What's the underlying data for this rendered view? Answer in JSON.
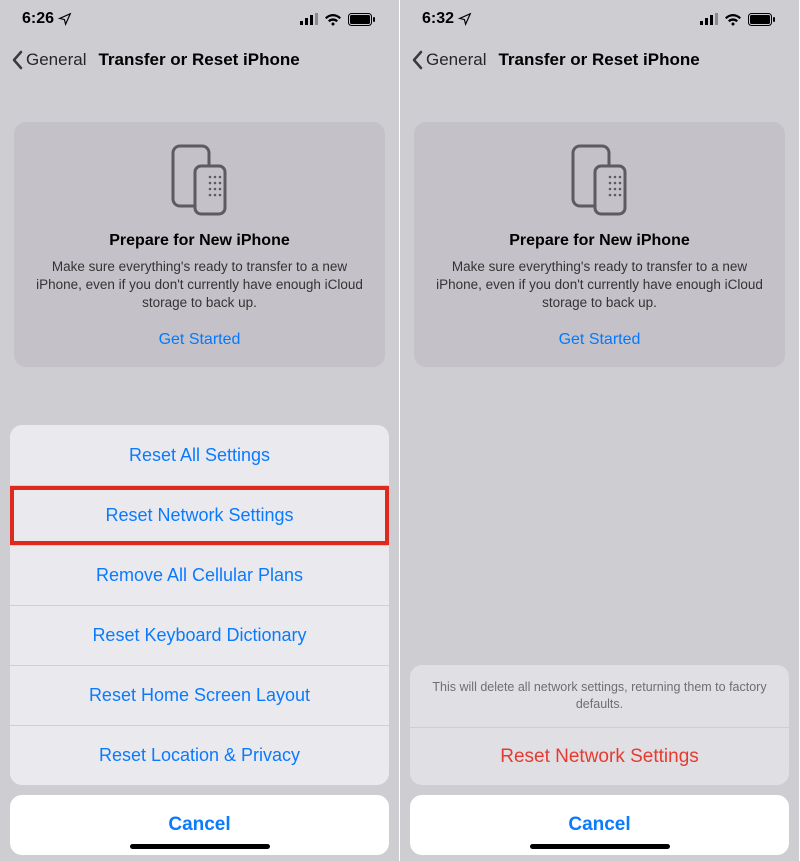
{
  "left": {
    "status": {
      "time": "6:26"
    },
    "nav": {
      "back": "General",
      "title": "Transfer or Reset iPhone"
    },
    "card": {
      "title": "Prepare for New iPhone",
      "body": "Make sure everything's ready to transfer to a new iPhone, even if you don't currently have enough iCloud storage to back up.",
      "cta": "Get Started"
    },
    "sheet": {
      "items": [
        "Reset All Settings",
        "Reset Network Settings",
        "Remove All Cellular Plans",
        "Reset Keyboard Dictionary",
        "Reset Home Screen Layout",
        "Reset Location & Privacy"
      ],
      "cancel": "Cancel"
    }
  },
  "right": {
    "status": {
      "time": "6:32"
    },
    "nav": {
      "back": "General",
      "title": "Transfer or Reset iPhone"
    },
    "card": {
      "title": "Prepare for New iPhone",
      "body": "Make sure everything's ready to transfer to a new iPhone, even if you don't currently have enough iCloud storage to back up.",
      "cta": "Get Started"
    },
    "confirm": {
      "message": "This will delete all network settings, returning them to factory defaults.",
      "action": "Reset Network Settings",
      "cancel": "Cancel"
    }
  }
}
